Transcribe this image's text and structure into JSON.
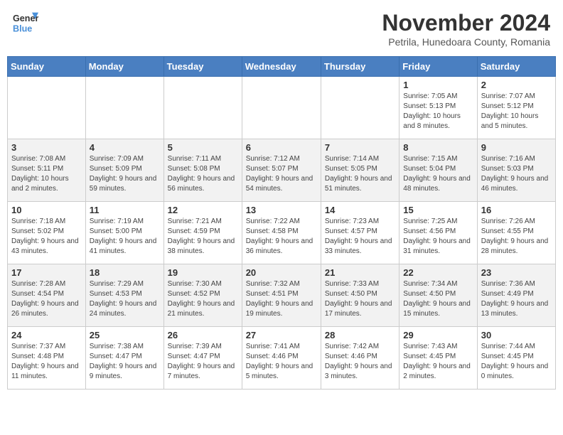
{
  "header": {
    "logo_line1": "General",
    "logo_line2": "Blue",
    "month_title": "November 2024",
    "subtitle": "Petrila, Hunedoara County, Romania"
  },
  "days_of_week": [
    "Sunday",
    "Monday",
    "Tuesday",
    "Wednesday",
    "Thursday",
    "Friday",
    "Saturday"
  ],
  "weeks": [
    [
      {
        "day": "",
        "info": ""
      },
      {
        "day": "",
        "info": ""
      },
      {
        "day": "",
        "info": ""
      },
      {
        "day": "",
        "info": ""
      },
      {
        "day": "",
        "info": ""
      },
      {
        "day": "1",
        "info": "Sunrise: 7:05 AM\nSunset: 5:13 PM\nDaylight: 10 hours and 8 minutes."
      },
      {
        "day": "2",
        "info": "Sunrise: 7:07 AM\nSunset: 5:12 PM\nDaylight: 10 hours and 5 minutes."
      }
    ],
    [
      {
        "day": "3",
        "info": "Sunrise: 7:08 AM\nSunset: 5:11 PM\nDaylight: 10 hours and 2 minutes."
      },
      {
        "day": "4",
        "info": "Sunrise: 7:09 AM\nSunset: 5:09 PM\nDaylight: 9 hours and 59 minutes."
      },
      {
        "day": "5",
        "info": "Sunrise: 7:11 AM\nSunset: 5:08 PM\nDaylight: 9 hours and 56 minutes."
      },
      {
        "day": "6",
        "info": "Sunrise: 7:12 AM\nSunset: 5:07 PM\nDaylight: 9 hours and 54 minutes."
      },
      {
        "day": "7",
        "info": "Sunrise: 7:14 AM\nSunset: 5:05 PM\nDaylight: 9 hours and 51 minutes."
      },
      {
        "day": "8",
        "info": "Sunrise: 7:15 AM\nSunset: 5:04 PM\nDaylight: 9 hours and 48 minutes."
      },
      {
        "day": "9",
        "info": "Sunrise: 7:16 AM\nSunset: 5:03 PM\nDaylight: 9 hours and 46 minutes."
      }
    ],
    [
      {
        "day": "10",
        "info": "Sunrise: 7:18 AM\nSunset: 5:02 PM\nDaylight: 9 hours and 43 minutes."
      },
      {
        "day": "11",
        "info": "Sunrise: 7:19 AM\nSunset: 5:00 PM\nDaylight: 9 hours and 41 minutes."
      },
      {
        "day": "12",
        "info": "Sunrise: 7:21 AM\nSunset: 4:59 PM\nDaylight: 9 hours and 38 minutes."
      },
      {
        "day": "13",
        "info": "Sunrise: 7:22 AM\nSunset: 4:58 PM\nDaylight: 9 hours and 36 minutes."
      },
      {
        "day": "14",
        "info": "Sunrise: 7:23 AM\nSunset: 4:57 PM\nDaylight: 9 hours and 33 minutes."
      },
      {
        "day": "15",
        "info": "Sunrise: 7:25 AM\nSunset: 4:56 PM\nDaylight: 9 hours and 31 minutes."
      },
      {
        "day": "16",
        "info": "Sunrise: 7:26 AM\nSunset: 4:55 PM\nDaylight: 9 hours and 28 minutes."
      }
    ],
    [
      {
        "day": "17",
        "info": "Sunrise: 7:28 AM\nSunset: 4:54 PM\nDaylight: 9 hours and 26 minutes."
      },
      {
        "day": "18",
        "info": "Sunrise: 7:29 AM\nSunset: 4:53 PM\nDaylight: 9 hours and 24 minutes."
      },
      {
        "day": "19",
        "info": "Sunrise: 7:30 AM\nSunset: 4:52 PM\nDaylight: 9 hours and 21 minutes."
      },
      {
        "day": "20",
        "info": "Sunrise: 7:32 AM\nSunset: 4:51 PM\nDaylight: 9 hours and 19 minutes."
      },
      {
        "day": "21",
        "info": "Sunrise: 7:33 AM\nSunset: 4:50 PM\nDaylight: 9 hours and 17 minutes."
      },
      {
        "day": "22",
        "info": "Sunrise: 7:34 AM\nSunset: 4:50 PM\nDaylight: 9 hours and 15 minutes."
      },
      {
        "day": "23",
        "info": "Sunrise: 7:36 AM\nSunset: 4:49 PM\nDaylight: 9 hours and 13 minutes."
      }
    ],
    [
      {
        "day": "24",
        "info": "Sunrise: 7:37 AM\nSunset: 4:48 PM\nDaylight: 9 hours and 11 minutes."
      },
      {
        "day": "25",
        "info": "Sunrise: 7:38 AM\nSunset: 4:47 PM\nDaylight: 9 hours and 9 minutes."
      },
      {
        "day": "26",
        "info": "Sunrise: 7:39 AM\nSunset: 4:47 PM\nDaylight: 9 hours and 7 minutes."
      },
      {
        "day": "27",
        "info": "Sunrise: 7:41 AM\nSunset: 4:46 PM\nDaylight: 9 hours and 5 minutes."
      },
      {
        "day": "28",
        "info": "Sunrise: 7:42 AM\nSunset: 4:46 PM\nDaylight: 9 hours and 3 minutes."
      },
      {
        "day": "29",
        "info": "Sunrise: 7:43 AM\nSunset: 4:45 PM\nDaylight: 9 hours and 2 minutes."
      },
      {
        "day": "30",
        "info": "Sunrise: 7:44 AM\nSunset: 4:45 PM\nDaylight: 9 hours and 0 minutes."
      }
    ]
  ]
}
